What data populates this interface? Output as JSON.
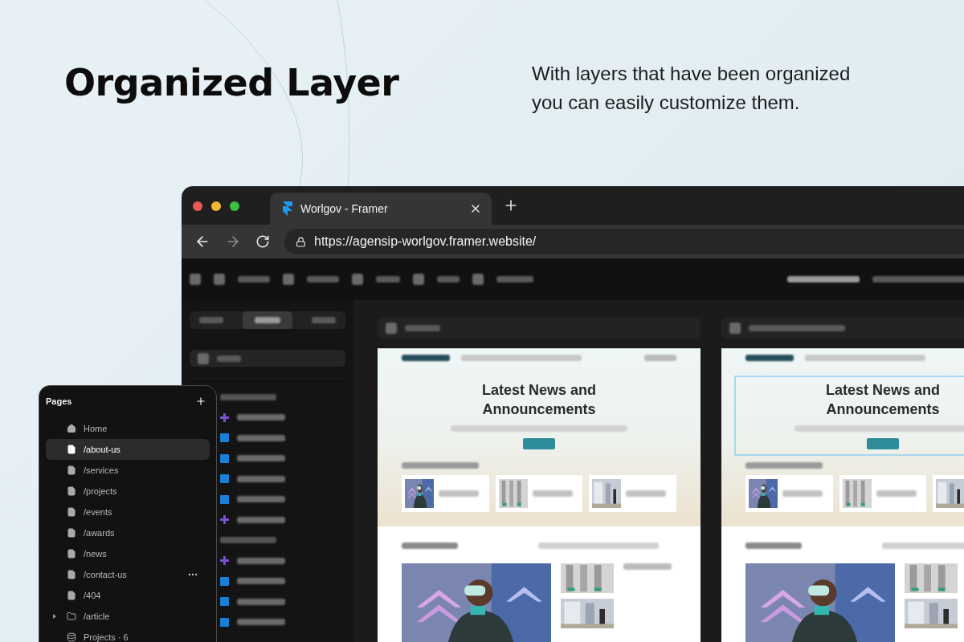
{
  "headline": "Organized Layer",
  "description": "With layers that have been organized you can easily customize them.",
  "browser": {
    "tab_title": "Worlgov - Framer",
    "url": "https://agensip-worlgov.framer.website/"
  },
  "layers": [
    {
      "kind": "group"
    },
    {
      "kind": "component"
    },
    {
      "kind": "frame"
    },
    {
      "kind": "frame"
    },
    {
      "kind": "frame"
    },
    {
      "kind": "frame"
    },
    {
      "kind": "component"
    },
    {
      "kind": "group"
    },
    {
      "kind": "component"
    },
    {
      "kind": "frame"
    },
    {
      "kind": "frame"
    },
    {
      "kind": "frame"
    }
  ],
  "pages_panel": {
    "title": "Pages",
    "items": [
      {
        "label": "Home",
        "kind": "home",
        "selected": false
      },
      {
        "label": "/about-us",
        "kind": "page",
        "selected": true
      },
      {
        "label": "/services",
        "kind": "page",
        "selected": false
      },
      {
        "label": "/projects",
        "kind": "page",
        "selected": false
      },
      {
        "label": "/events",
        "kind": "page",
        "selected": false
      },
      {
        "label": "/awards",
        "kind": "page",
        "selected": false
      },
      {
        "label": "/news",
        "kind": "page",
        "selected": false
      },
      {
        "label": "/contact-us",
        "kind": "page",
        "selected": false,
        "hovered": true
      },
      {
        "label": "/404",
        "kind": "page",
        "selected": false
      },
      {
        "label": "/article",
        "kind": "folder",
        "selected": false
      },
      {
        "label": "Projects · 6",
        "kind": "collection",
        "selected": false
      }
    ]
  },
  "previews": [
    {
      "headline": "Latest News and Announcements",
      "selected": false
    },
    {
      "headline": "Latest News and Announcements",
      "selected": true
    }
  ]
}
